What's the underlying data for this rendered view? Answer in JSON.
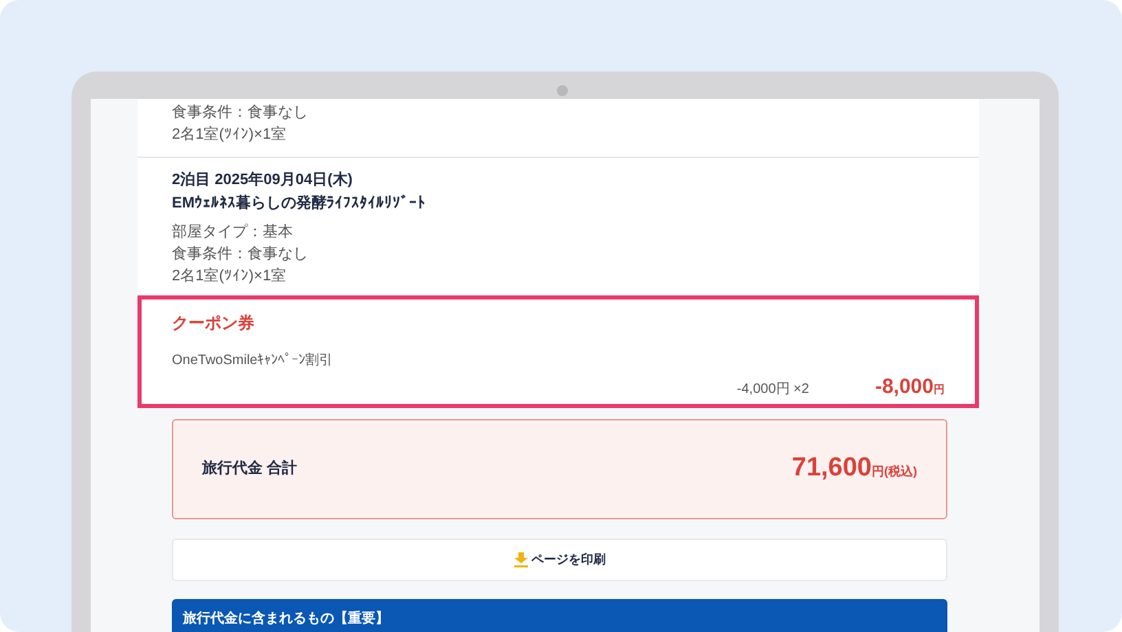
{
  "nights": [
    {
      "lines": [
        "食事条件：食事なし",
        "2名1室(ﾂｲﾝ)×1室"
      ]
    },
    {
      "heading": "2泊目 2025年09月04日(木)",
      "hotel": "EMｳｪﾙﾈｽ暮らしの発酵ﾗｲﾌｽﾀｲﾙﾘｿﾞｰﾄ",
      "lines": [
        "部屋タイプ：基本",
        "食事条件：食事なし",
        "2名1室(ﾂｲﾝ)×1室"
      ]
    }
  ],
  "coupon": {
    "title": "クーポン券",
    "name": "OneTwoSmileｷｬﾝﾍﾟｰﾝ割引",
    "unit": "-4,000円 ×2",
    "amount": "-8,000",
    "currency": "円"
  },
  "total": {
    "label": "旅行代金 合計",
    "amount": "71,600",
    "suffix": "円(税込)"
  },
  "print_button": "ページを印刷",
  "included_heading": "旅行代金に含まれるもの【重要】"
}
